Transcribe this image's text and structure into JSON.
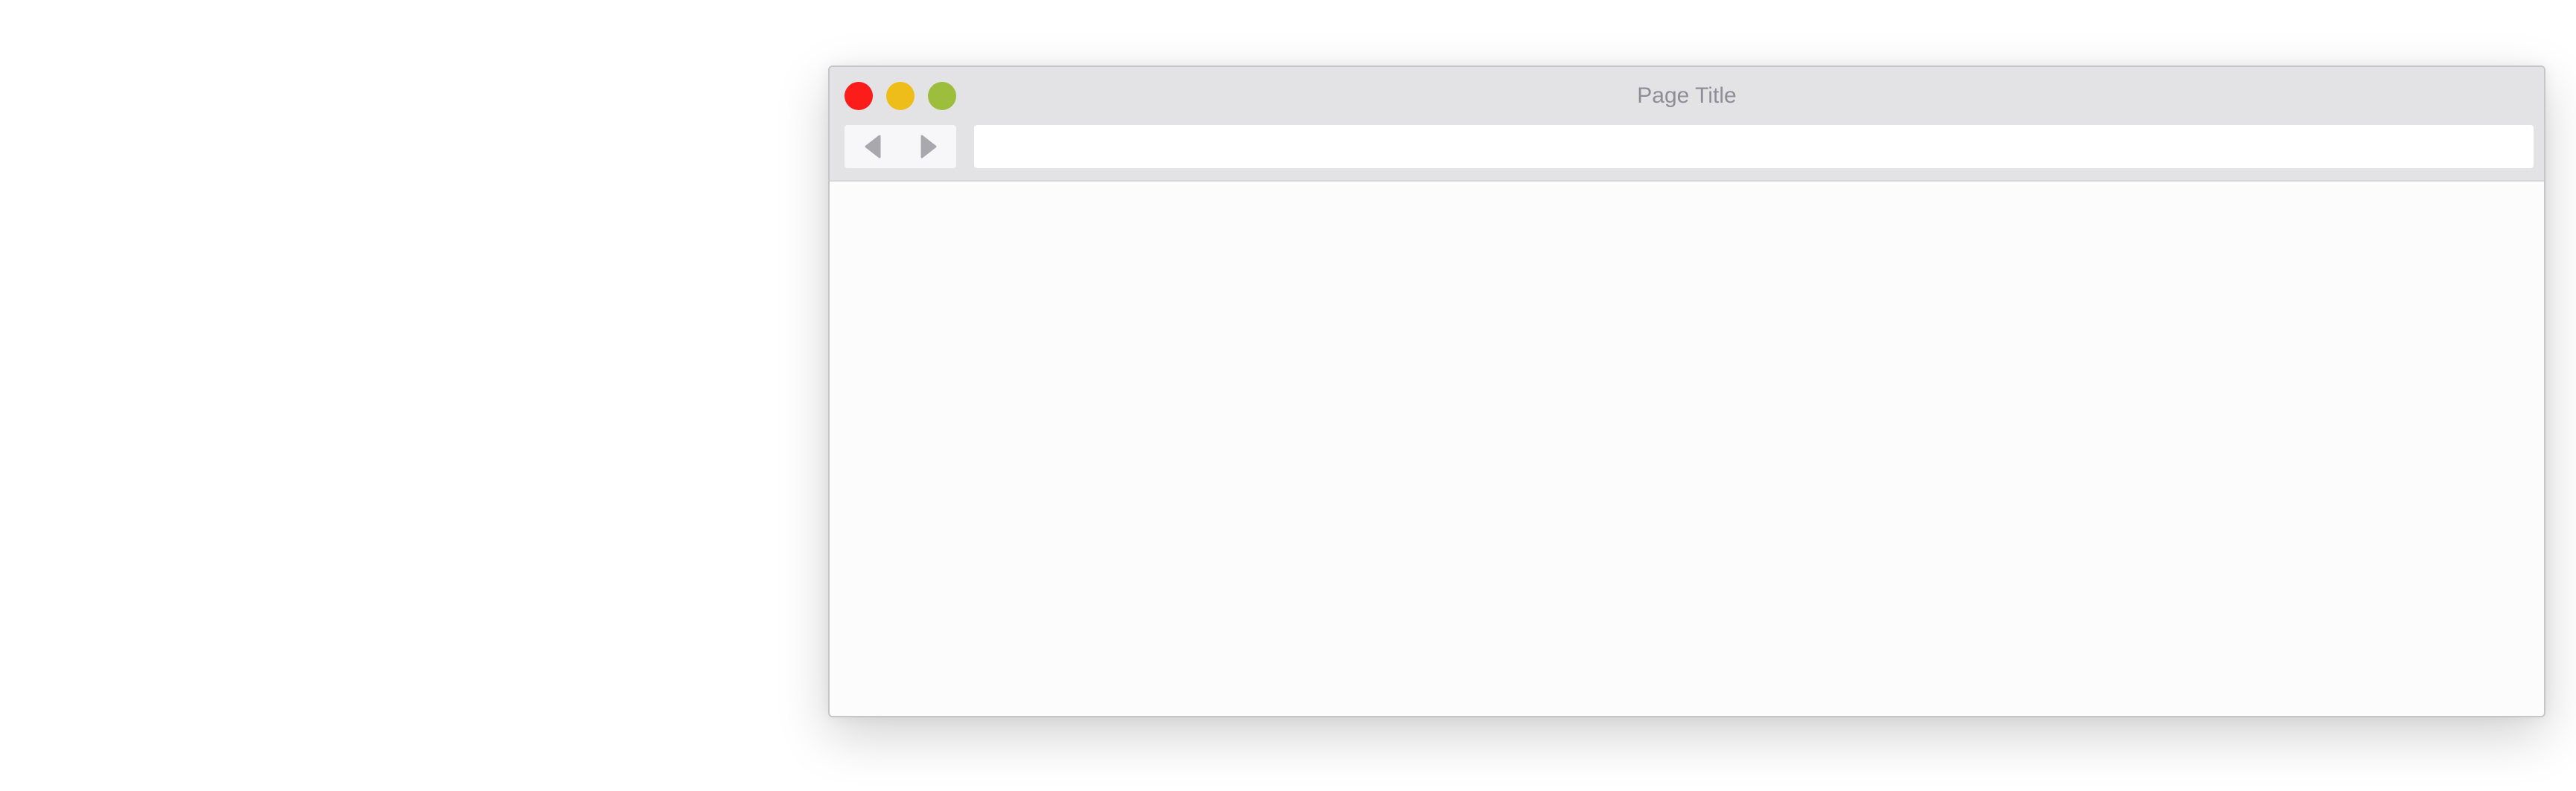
{
  "window": {
    "title": "Page Title",
    "controls": {
      "close_color": "#fc1d1a",
      "minimize_color": "#efbd19",
      "zoom_color": "#9dbd3c"
    }
  },
  "toolbar": {
    "back_icon": "back-arrow-icon",
    "forward_icon": "forward-arrow-icon",
    "address": {
      "value": "",
      "placeholder": ""
    }
  }
}
